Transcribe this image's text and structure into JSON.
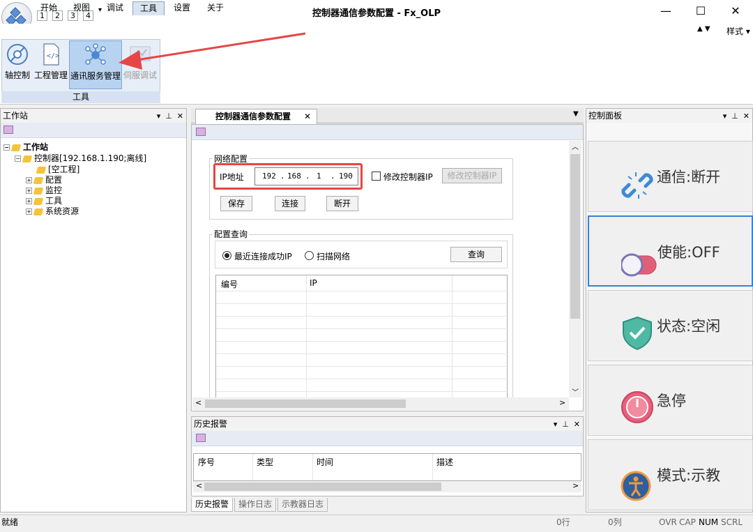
{
  "window": {
    "title": "控制器通信参数配置 - Fx_OLP",
    "minimize": "—",
    "maximize": "☐",
    "close": "✕"
  },
  "quick_access": [
    "1",
    "2",
    "3",
    "4"
  ],
  "menu": {
    "items": [
      "开始",
      "视图",
      "调试",
      "工具",
      "设置",
      "关于"
    ],
    "active": "工具",
    "style_label": "样式",
    "style_arrows": "▲ ▼"
  },
  "ribbon": {
    "buttons": [
      {
        "label": "轴控制",
        "icon": "axis-control-icon"
      },
      {
        "label": "工程管理",
        "icon": "project-code-icon"
      },
      {
        "label": "通讯服务管理",
        "icon": "network-service-icon",
        "selected": true
      },
      {
        "label": "伺服调试",
        "icon": "servo-debug-icon",
        "disabled": true
      }
    ],
    "group_label": "工具"
  },
  "workstation": {
    "title": "工作站",
    "tree": [
      {
        "label": "工作站",
        "bold": true
      },
      {
        "label": "控制器[192.168.1.190;离线]"
      },
      {
        "label": "[空工程]"
      },
      {
        "label": "配置"
      },
      {
        "label": "监控"
      },
      {
        "label": "工具"
      },
      {
        "label": "系统资源"
      }
    ]
  },
  "document": {
    "tab_title": "控制器通信参数配置",
    "network_group": "网络配置",
    "ip_label": "IP地址",
    "ip": [
      "192",
      "168",
      "1",
      "190"
    ],
    "modify_ip_checkbox": "修改控制器IP",
    "modify_ip_button": "修改控制器IP",
    "buttons": {
      "save": "保存",
      "connect": "连接",
      "disconnect": "断开"
    },
    "query_group": "配置查询",
    "radio_recent": "最近连接成功IP",
    "radio_scan": "扫描网络",
    "query_button": "查询",
    "columns": [
      "编号",
      "IP"
    ]
  },
  "history": {
    "title": "历史报警",
    "columns": [
      "序号",
      "类型",
      "时间",
      "描述"
    ],
    "tabs": [
      "历史报警",
      "操作日志",
      "示教器日志"
    ]
  },
  "control_panel": {
    "title": "控制面板",
    "buttons": [
      {
        "label": "通信:断开",
        "icon": "broken-link-icon"
      },
      {
        "label": "使能:OFF",
        "icon": "toggle-off-icon"
      },
      {
        "label": "状态:空闲",
        "icon": "shield-check-icon"
      },
      {
        "label": "急停",
        "icon": "power-stop-icon"
      },
      {
        "label": "模式:示教",
        "icon": "person-mode-icon"
      }
    ]
  },
  "status": {
    "left": "就绪",
    "row": "0行",
    "col": "0列",
    "flags": [
      "OVR",
      "CAP",
      "NUM",
      "SCRL"
    ]
  },
  "colors": {
    "annotation_red": "#e64545",
    "accent_blue": "#3b7ed6"
  }
}
